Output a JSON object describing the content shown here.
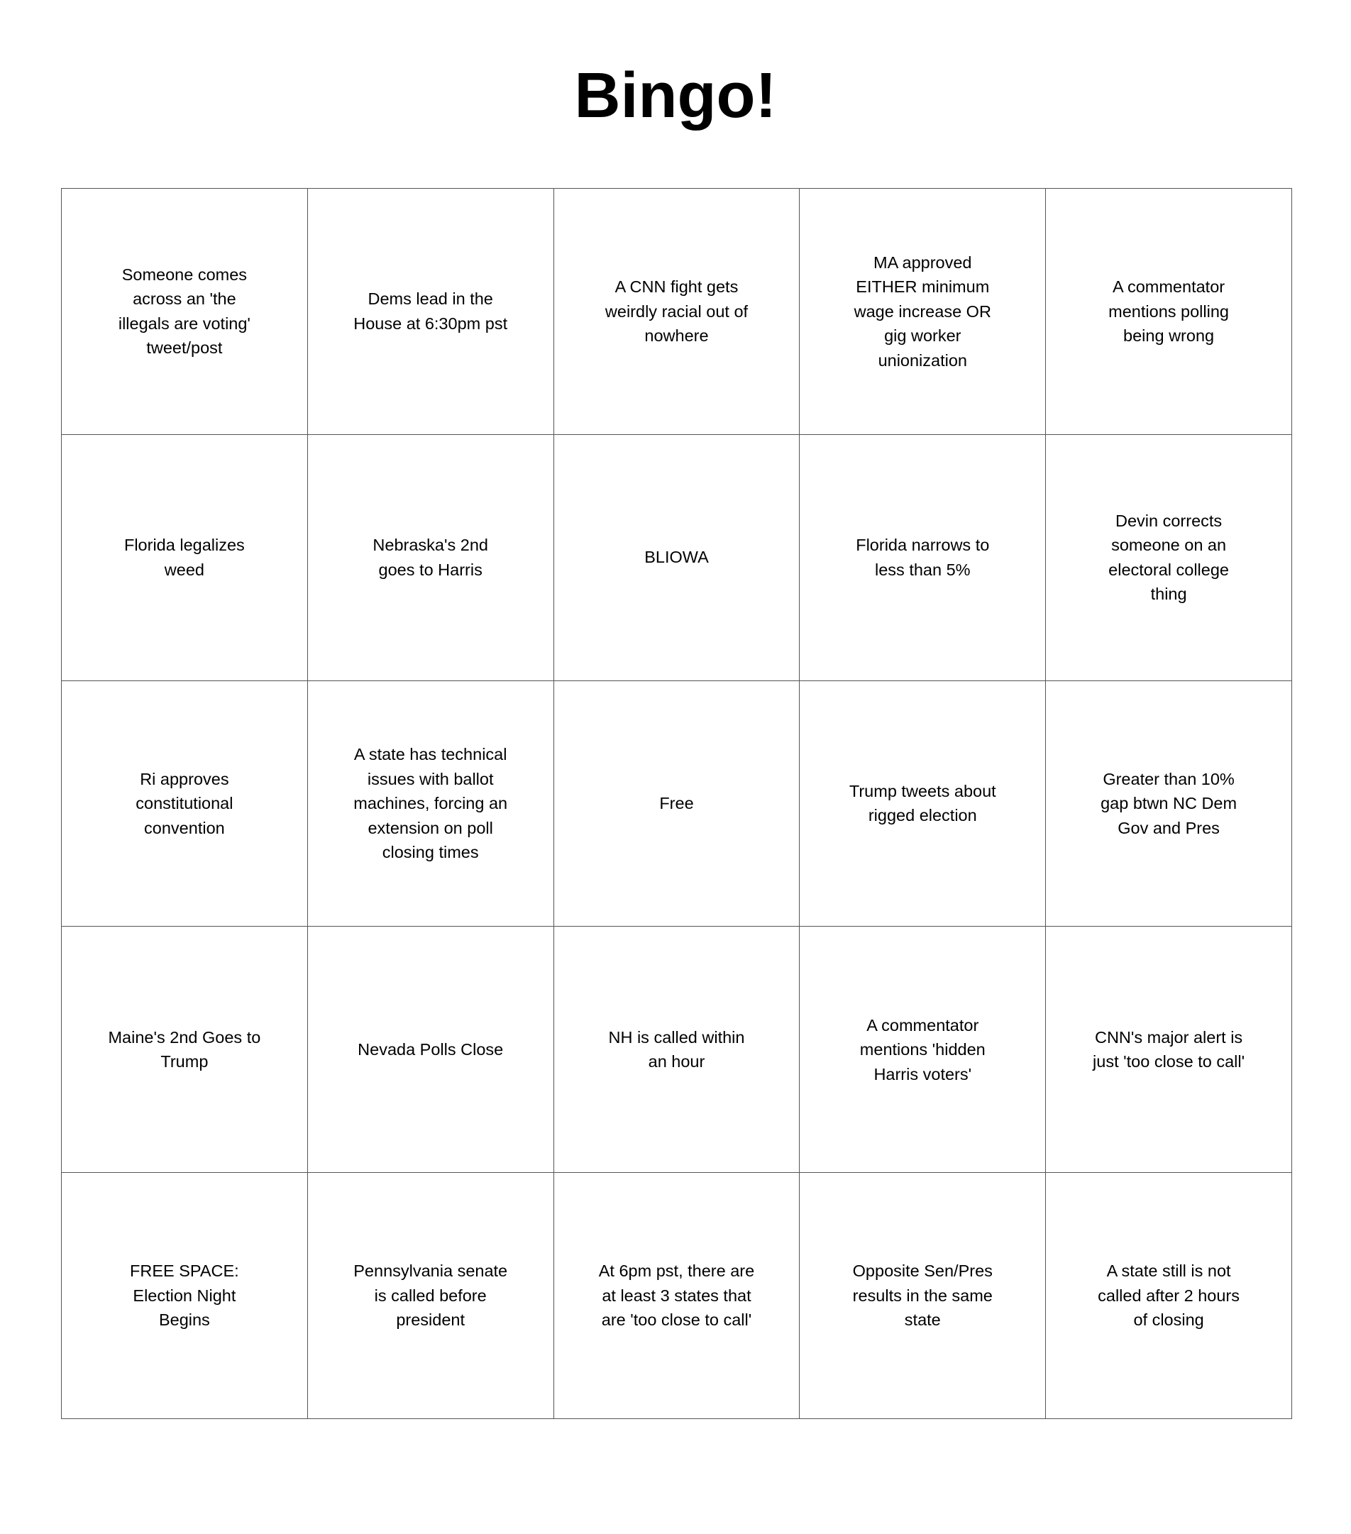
{
  "title": "Bingo!",
  "cells": [
    "Someone comes across an 'the illegals are voting' tweet/post",
    "Dems lead in the House at 6:30pm pst",
    "A CNN fight gets weirdly racial out of nowhere",
    "MA approved EITHER minimum wage increase OR gig worker unionization",
    "A commentator mentions polling being wrong",
    "Florida legalizes weed",
    "Nebraska's 2nd goes to Harris",
    "BLIOWA",
    "Florida narrows to less than 5%",
    "Devin corrects someone on an electoral college thing",
    "Ri approves constitutional convention",
    "A state has technical issues with ballot machines, forcing an extension on poll closing times",
    "Free",
    "Trump tweets about rigged election",
    "Greater than 10% gap btwn NC Dem Gov and Pres",
    "Maine's 2nd Goes to Trump",
    "Nevada Polls Close",
    "NH is called within an hour",
    "A commentator mentions 'hidden Harris voters'",
    "CNN's major alert is just 'too close to call'",
    "FREE SPACE: Election Night Begins",
    "Pennsylvania senate is called before president",
    "At 6pm pst, there are at least 3 states that are 'too close to call'",
    "Opposite Sen/Pres results in the same state",
    "A state still is not called after 2 hours of closing"
  ]
}
